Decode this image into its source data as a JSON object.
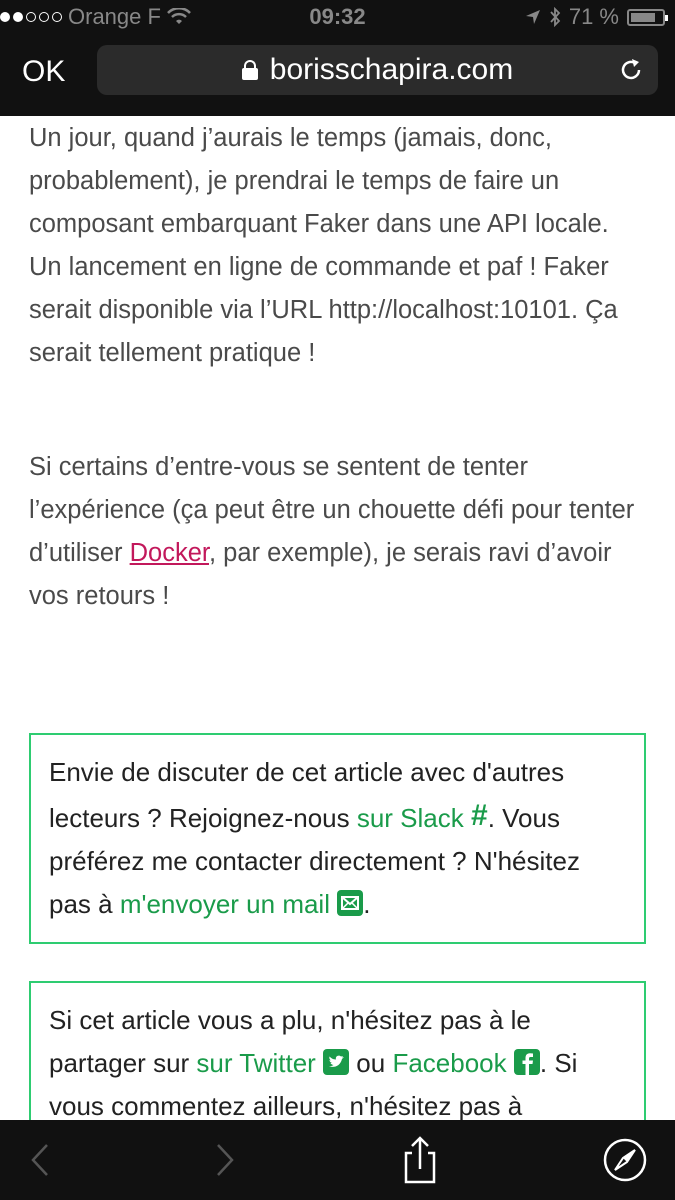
{
  "status_bar": {
    "carrier": "Orange F",
    "time": "09:32",
    "battery": "71 %",
    "battery_level": 0.71
  },
  "browser": {
    "done_label": "OK",
    "url": "borisschapira.com"
  },
  "article": {
    "p1": "Un jour, quand j’aurais le temps (jamais, donc, probablement), je prendrai le temps de faire un composant embarquant Faker dans une API locale. Un lancement en ligne de commande et paf ! Faker serait disponible via l’URL http://localhost:10101. Ça serait tellement pratique !",
    "p2_before": "Si certains d’entre-vous se sentent de tenter l’expérience (ça peut être un chouette défi pour tenter d’utiliser ",
    "p2_link": "Docker",
    "p2_after": ", par exemple), je serais ravi d’avoir vos retours !"
  },
  "callout_discuss": {
    "text1": "Envie de discuter de cet article avec d'autres lecteurs ? Rejoignez-nous ",
    "slack_link": "sur Slack",
    "text2": ". Vous préférez me contacter directement ? N'hésitez pas à ",
    "mail_link": "m'envoyer un mail",
    "text3": "."
  },
  "callout_share": {
    "text1": "Si cet article vous a plu, n'hésitez pas à le partager sur ",
    "twitter_link": "sur Twitter",
    "text2": " ou ",
    "facebook_link": "Facebook",
    "text3": ".",
    "text4": " Si vous commentez ailleurs, n'hésitez pas à"
  },
  "colors": {
    "link_pink": "#c2185b",
    "link_green": "#1a9b4a",
    "border_green": "#2ecc71"
  }
}
